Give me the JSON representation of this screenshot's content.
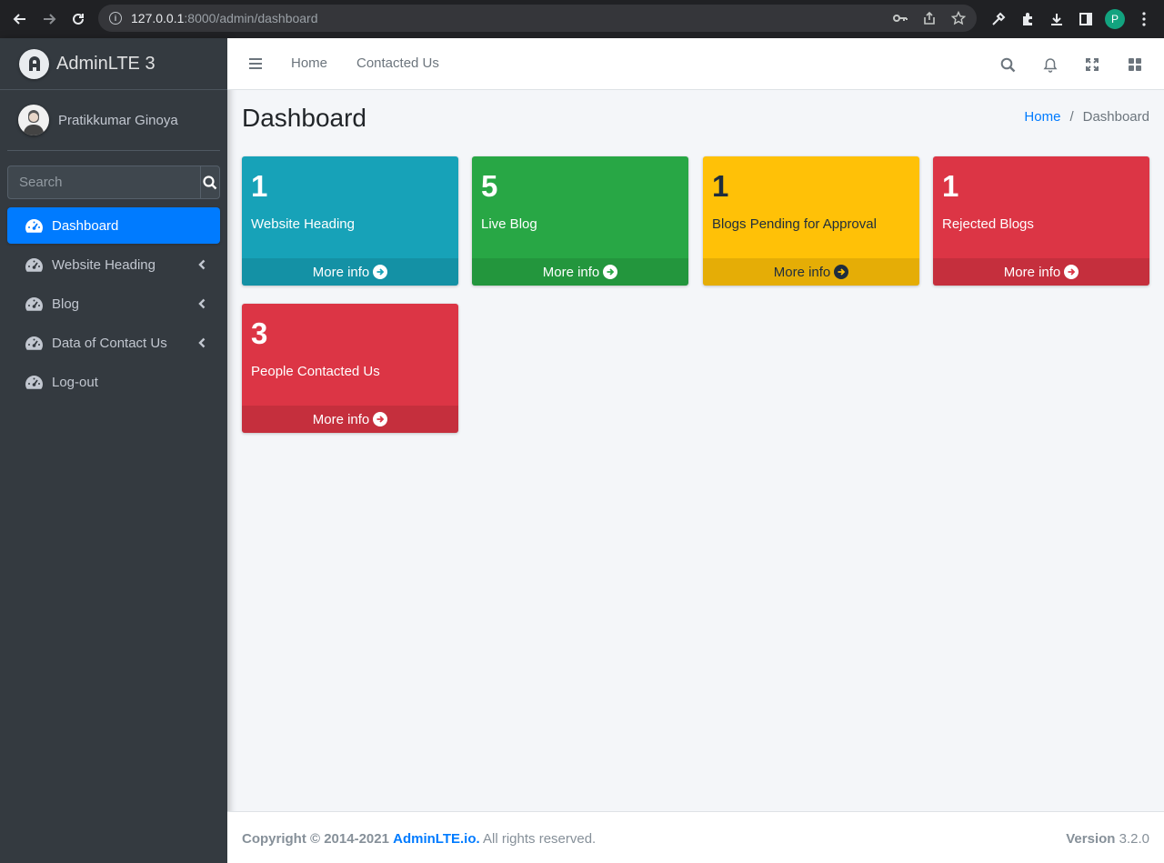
{
  "browser": {
    "url_host": "127.0.0.1",
    "url_path": ":8000/admin/dashboard",
    "profile_initial": "P"
  },
  "sidebar": {
    "brand": "AdminLTE 3",
    "user_name": "Pratikkumar Ginoya",
    "search_placeholder": "Search",
    "items": [
      {
        "label": "Dashboard",
        "icon": "gauge-icon",
        "active": true,
        "has_children": false
      },
      {
        "label": "Website Heading",
        "icon": "gauge-icon",
        "active": false,
        "has_children": true
      },
      {
        "label": "Blog",
        "icon": "gauge-icon",
        "active": false,
        "has_children": true
      },
      {
        "label": "Data of Contact Us",
        "icon": "gauge-icon",
        "active": false,
        "has_children": true
      },
      {
        "label": "Log-out",
        "icon": "gauge-icon",
        "active": false,
        "has_children": false
      }
    ]
  },
  "header": {
    "links": [
      "Home",
      "Contacted Us"
    ],
    "icons": [
      "search-icon",
      "bell-icon",
      "expand-icon",
      "grid-icon"
    ]
  },
  "page": {
    "title": "Dashboard",
    "breadcrumb": [
      "Home",
      "Dashboard"
    ]
  },
  "boxes": [
    {
      "count": "1",
      "label": "Website Heading",
      "more": "More info",
      "color": "#17a2b8"
    },
    {
      "count": "5",
      "label": "Live Blog",
      "more": "More info",
      "color": "#28a745"
    },
    {
      "count": "1",
      "label": "Blogs Pending for Approval",
      "more": "More info",
      "color": "#ffc107"
    },
    {
      "count": "1",
      "label": "Rejected Blogs",
      "more": "More info",
      "color": "#dc3545"
    },
    {
      "count": "3",
      "label": "People Contacted Us",
      "more": "More info",
      "color": "#dc3545"
    }
  ],
  "footer": {
    "copyright": "Copyright © 2014-2021",
    "brand_link": "AdminLTE.io.",
    "rights": "All rights reserved.",
    "version_label": "Version",
    "version": "3.2.0"
  }
}
